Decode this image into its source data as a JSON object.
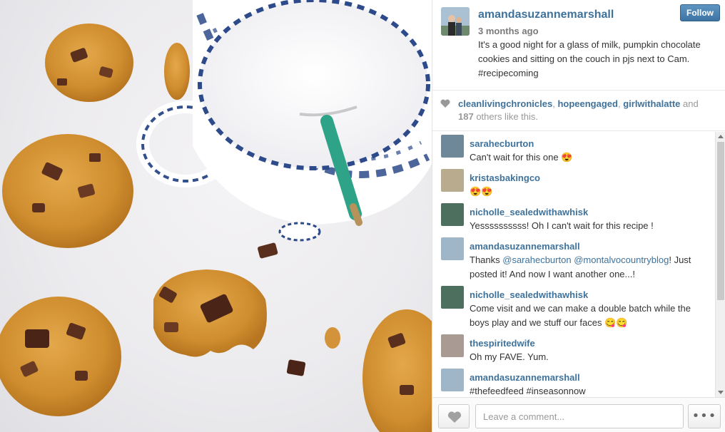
{
  "post": {
    "owner": "amandasuzannemarshall",
    "follow_label": "Follow",
    "time_ago": "3 months ago",
    "caption": "It's a good night for a glass of milk, pumpkin chocolate cookies and sitting on the couch in pjs next to Cam. #recipecoming"
  },
  "likes": {
    "users": [
      "cleanlivingchronicles",
      "hopeengaged",
      "girlwithalatte"
    ],
    "sep1": ", ",
    "sep2": ", ",
    "and_text": " and ",
    "others_count": "187",
    "others_suffix": " others like this."
  },
  "comments": [
    {
      "user": "sarahecburton",
      "text": "Can't wait for this one ",
      "emoji": "😍",
      "avatar_color": "#6e8799"
    },
    {
      "user": "kristasbakingco",
      "text": "",
      "emoji": "😍😍",
      "avatar_color": "#b9ab8e"
    },
    {
      "user": "nicholle_sealedwithawhisk",
      "text": "Yessssssssss! Oh I can't wait for this recipe !",
      "emoji": "",
      "avatar_color": "#4d6f5d"
    },
    {
      "user": "amandasuzannemarshall",
      "text_before": "Thanks ",
      "mention1": "@sarahecburton",
      "between": " ",
      "mention2": "@montalvocountryblog",
      "text_after": "! Just posted it! And now I want another one...!",
      "avatar_color": "#9fb6c8"
    },
    {
      "user": "nicholle_sealedwithawhisk",
      "text": "Come visit and we can make a double batch while the boys play and we stuff our faces ",
      "emoji": "😋😋",
      "avatar_color": "#4d6f5d"
    },
    {
      "user": "thespiritedwife",
      "text": "Oh my FAVE. Yum.",
      "emoji": "",
      "avatar_color": "#a99a93"
    },
    {
      "user": "amandasuzannemarshall",
      "text": "#thefeedfeed #inseasonnow",
      "emoji": "",
      "avatar_color": "#9fb6c8"
    }
  ],
  "comment_box": {
    "placeholder": "Leave a comment..."
  },
  "more_label": "•••",
  "colors": {
    "link": "#3f729b",
    "follow_button": "#3d74a4"
  },
  "icons": {
    "like": "heart-icon",
    "more": "ellipsis-icon"
  }
}
